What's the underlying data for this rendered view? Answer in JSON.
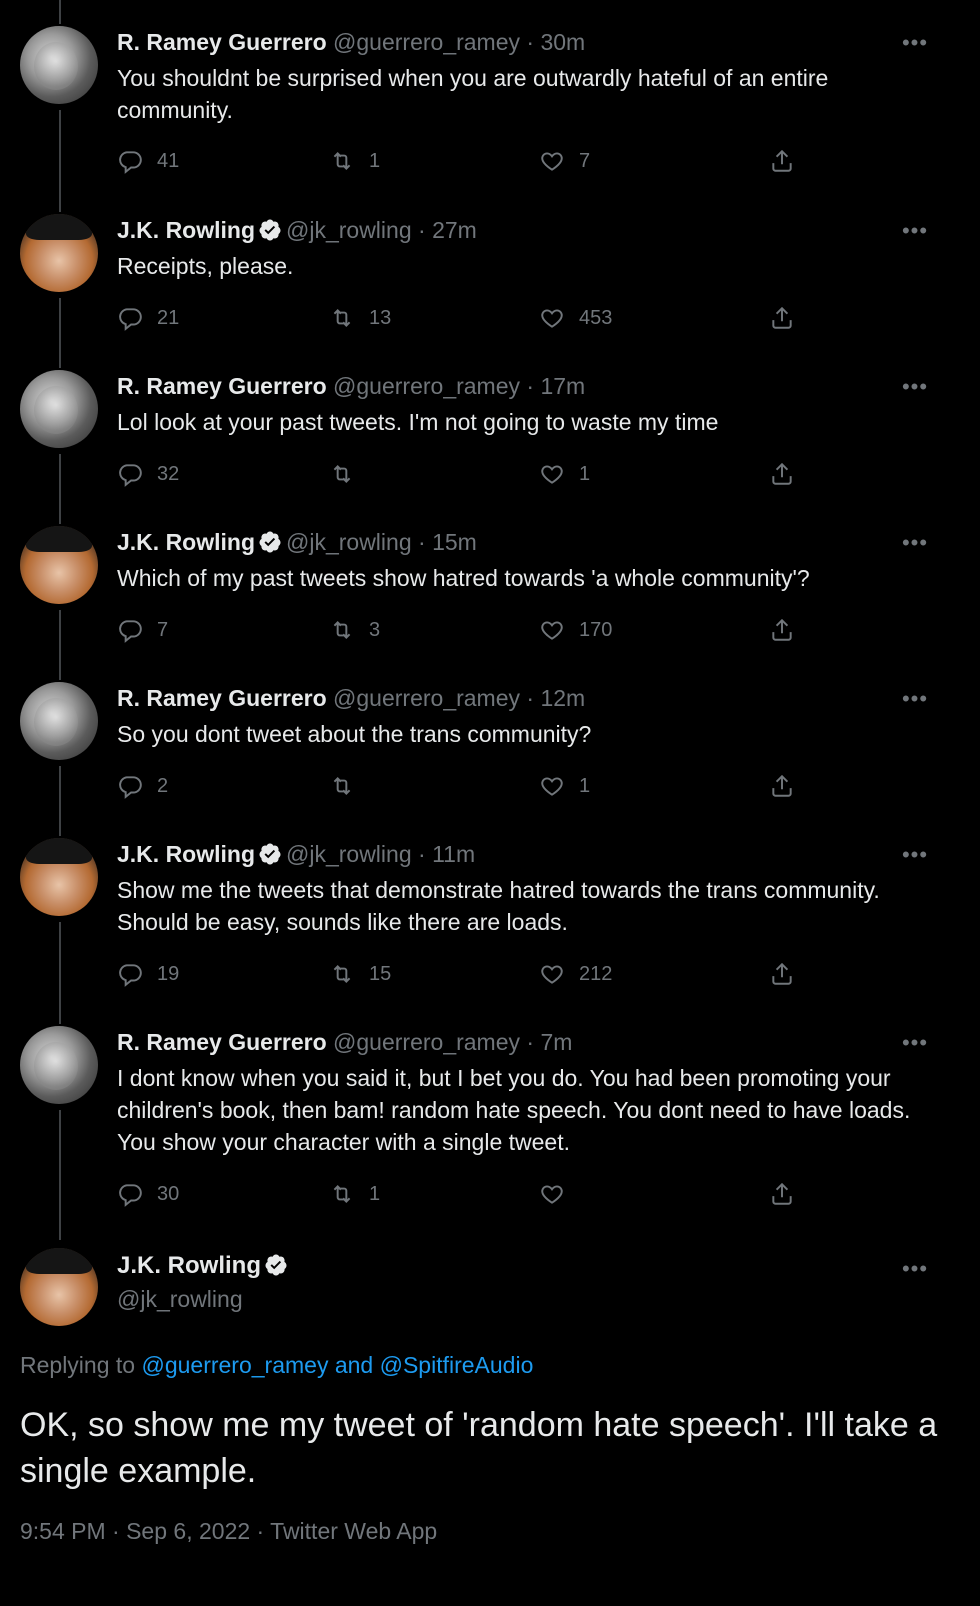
{
  "tweets": [
    {
      "name": "R. Ramey Guerrero",
      "verified": false,
      "handle": "@guerrero_ramey",
      "time": "30m",
      "text": "You shouldnt be surprised when you are outwardly hateful of an entire community.",
      "replies": "41",
      "retweets": "1",
      "likes": "7",
      "avatar": "ramey"
    },
    {
      "name": "J.K. Rowling",
      "verified": true,
      "handle": "@jk_rowling",
      "time": "27m",
      "text": "Receipts, please.",
      "replies": "21",
      "retweets": "13",
      "likes": "453",
      "avatar": "jk"
    },
    {
      "name": "R. Ramey Guerrero",
      "verified": false,
      "handle": "@guerrero_ramey",
      "time": "17m",
      "text": "Lol look at your past tweets. I'm not going to waste my time",
      "replies": "32",
      "retweets": "",
      "likes": "1",
      "avatar": "ramey"
    },
    {
      "name": "J.K. Rowling",
      "verified": true,
      "handle": "@jk_rowling",
      "time": "15m",
      "text": "Which of my past tweets show hatred towards 'a whole community'?",
      "replies": "7",
      "retweets": "3",
      "likes": "170",
      "avatar": "jk"
    },
    {
      "name": "R. Ramey Guerrero",
      "verified": false,
      "handle": "@guerrero_ramey",
      "time": "12m",
      "text": "So you dont tweet about the trans community?",
      "replies": "2",
      "retweets": "",
      "likes": "1",
      "avatar": "ramey"
    },
    {
      "name": "J.K. Rowling",
      "verified": true,
      "handle": "@jk_rowling",
      "time": "11m",
      "text": "Show me the tweets that demonstrate hatred towards the trans community. Should be easy, sounds like there are loads.",
      "replies": "19",
      "retweets": "15",
      "likes": "212",
      "avatar": "jk"
    },
    {
      "name": "R. Ramey Guerrero",
      "verified": false,
      "handle": "@guerrero_ramey",
      "time": "7m",
      "text": "I dont know when you said it, but I bet you do. You had been promoting your children's book, then bam! random hate speech. You dont need to have loads. You show your character with a single tweet.",
      "replies": "30",
      "retweets": "1",
      "likes": "",
      "avatar": "ramey"
    }
  ],
  "main": {
    "name": "J.K. Rowling",
    "handle": "@jk_rowling",
    "replying_prefix": "Replying to ",
    "replying_links": "@guerrero_ramey and @SpitfireAudio",
    "text": "OK, so show me my tweet of 'random hate speech'. I'll take a single example.",
    "meta": "9:54 PM · Sep 6, 2022 · Twitter Web App"
  },
  "icons": {
    "reply": "reply-icon",
    "retweet": "retweet-icon",
    "like": "heart-icon",
    "share": "share-icon",
    "more": "more-icon",
    "verified": "verified-badge-icon"
  },
  "colors": {
    "background": "#000000",
    "text": "#e7e9ea",
    "muted": "#71767b",
    "link": "#1d9bf0",
    "thread_line": "#3e4144"
  }
}
